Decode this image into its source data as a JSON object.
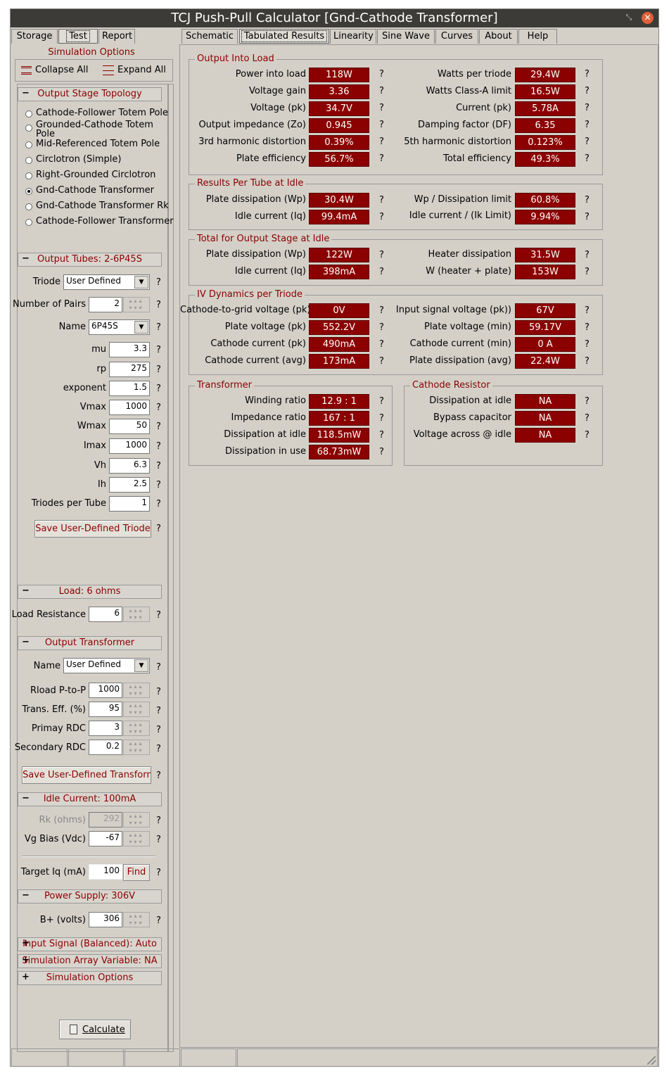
{
  "window": {
    "title": "TCJ Push-Pull Calculator [Gnd-Cathode Transformer]"
  },
  "left_tabs": [
    "Storage",
    "Test",
    "Report"
  ],
  "right_tabs": [
    "Schematic",
    "Tabulated Results",
    "Linearity",
    "Sine Wave",
    "Curves",
    "About",
    "Help"
  ],
  "sim_options": {
    "title": "Simulation Options",
    "collapse": "Collapse All",
    "expand": "Expand All"
  },
  "topology": {
    "title": "Output Stage Topology",
    "options": [
      "Cathode-Follower Totem Pole",
      "Grounded-Cathode Totem Pole",
      "Mid-Referenced Totem Pole",
      "Circlotron (Simple)",
      "Right-Grounded Circlotron",
      "Gnd-Cathode Transformer",
      "Gnd-Cathode Transformer Rk",
      "Cathode-Follower Transformer"
    ],
    "selected": "Gnd-Cathode Transformer"
  },
  "tubes": {
    "title": "Output Tubes: 2-6P45S",
    "triode_label": "Triode",
    "triode_value": "User Defined",
    "pairs_label": "Number of Pairs",
    "pairs_value": "2",
    "name_label": "Name",
    "name_value": "6P45S",
    "mu_label": "mu",
    "mu": "3.3",
    "rp_label": "rp",
    "rp": "275",
    "exponent_label": "exponent",
    "exponent": "1.5",
    "vmax_label": "Vmax",
    "vmax": "1000",
    "wmax_label": "Wmax",
    "wmax": "50",
    "imax_label": "Imax",
    "imax": "1000",
    "vh_label": "Vh",
    "vh": "6.3",
    "ih_label": "Ih",
    "ih": "2.5",
    "tpt_label": "Triodes per Tube",
    "tpt": "1",
    "save_btn": "Save User-Defined Triode"
  },
  "load": {
    "title": "Load: 6 ohms",
    "label": "Load Resistance",
    "value": "6"
  },
  "transformer": {
    "title": "Output Transformer",
    "name_label": "Name",
    "name_value": "User Defined",
    "rload_label": "Rload P-to-P",
    "rload": "1000",
    "eff_label": "Trans. Eff. (%)",
    "eff": "95",
    "prdc_label": "Primay RDC",
    "prdc": "3",
    "srdc_label": "Secondary RDC",
    "srdc": "0.2",
    "save_btn": "Save User-Defined Transformer"
  },
  "idle": {
    "title": "Idle Current: 100mA",
    "rk_label": "Rk (ohms)",
    "rk": "292",
    "vg_label": "Vg Bias (Vdc)",
    "vg": "-67",
    "target_label": "Target Iq (mA)",
    "target": "100",
    "find_btn": "Find"
  },
  "power": {
    "title": "Power Supply: 306V",
    "bplus_label": "B+ (volts)",
    "bplus": "306"
  },
  "collapsed": [
    "Input Signal (Balanced): Auto",
    "Simulation Array Variable: NA",
    "Simulation Options"
  ],
  "calculate": "Calculate",
  "q": "?",
  "results": {
    "output_into_load": {
      "title": "Output Into Load",
      "left": [
        [
          "Power into load",
          "118W"
        ],
        [
          "Voltage gain",
          "3.36"
        ],
        [
          "Voltage (pk)",
          "34.7V"
        ],
        [
          "Output impedance (Zo)",
          "0.945"
        ],
        [
          "3rd harmonic distortion",
          "0.39%"
        ],
        [
          "Plate efficiency",
          "56.7%"
        ]
      ],
      "right": [
        [
          "Watts per triode",
          "29.4W"
        ],
        [
          "Watts Class-A limit",
          "16.5W"
        ],
        [
          "Current (pk)",
          "5.78A"
        ],
        [
          "Damping factor (DF)",
          "6.35"
        ],
        [
          "5th harmonic distortion",
          "0.123%"
        ],
        [
          "Total efficiency",
          "49.3%"
        ]
      ]
    },
    "per_tube": {
      "title": "Results Per Tube at Idle",
      "left": [
        [
          "Plate dissipation (Wp)",
          "30.4W"
        ],
        [
          "Idle current (Iq)",
          "99.4mA"
        ]
      ],
      "right": [
        [
          "Wp / Dissipation limit",
          "60.8%"
        ],
        [
          "Idle current / (Ik Limit)",
          "9.94%"
        ]
      ]
    },
    "total": {
      "title": "Total for Output Stage at Idle",
      "left": [
        [
          "Plate dissipation (Wp)",
          "122W"
        ],
        [
          "Idle current (Iq)",
          "398mA"
        ]
      ],
      "right": [
        [
          "Heater dissipation",
          "31.5W"
        ],
        [
          "W (heater + plate)",
          "153W"
        ]
      ]
    },
    "iv": {
      "title": "IV Dynamics per Triode",
      "left": [
        [
          "Cathode-to-grid voltage (pk)",
          "0V"
        ],
        [
          "Plate voltage (pk)",
          "552.2V"
        ],
        [
          "Cathode current (pk)",
          "490mA"
        ],
        [
          "Cathode current (avg)",
          "173mA"
        ]
      ],
      "right": [
        [
          "Input signal voltage (pk))",
          "67V"
        ],
        [
          "Plate voltage (min)",
          "59.17V"
        ],
        [
          "Cathode current (min)",
          "0 A"
        ],
        [
          "Plate dissipation (avg)",
          "22.4W"
        ]
      ]
    },
    "transformer": {
      "title": "Transformer",
      "rows": [
        [
          "Winding ratio",
          "12.9 : 1"
        ],
        [
          "Impedance ratio",
          "167 : 1"
        ],
        [
          "Dissipation at idle",
          "118.5mW"
        ],
        [
          "Dissipation in use",
          "68.73mW"
        ]
      ]
    },
    "cathode_resistor": {
      "title": "Cathode Resistor",
      "rows": [
        [
          "Dissipation at idle",
          "NA"
        ],
        [
          "Bypass capacitor",
          "NA"
        ],
        [
          "Voltage across @ idle",
          "NA"
        ]
      ]
    }
  }
}
